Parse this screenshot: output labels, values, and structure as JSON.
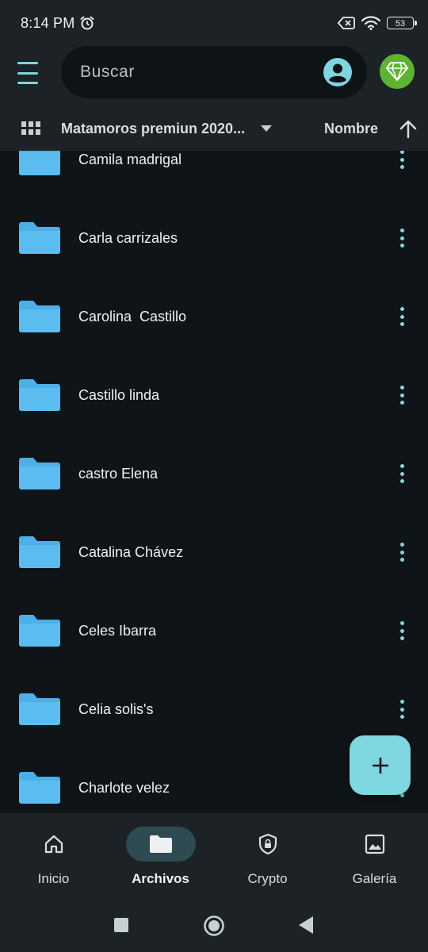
{
  "status_bar": {
    "time": "8:14 PM",
    "battery": "53",
    "icons": [
      "alarm-icon",
      "sim-error-icon",
      "wifi-icon",
      "battery-icon"
    ]
  },
  "topbar": {
    "search_placeholder": "Buscar",
    "icons": [
      "menu-icon",
      "account-icon",
      "diamond-icon"
    ]
  },
  "pathbar": {
    "folder_title": "Matamoros premiun 2020...",
    "sort_label": "Nombre",
    "icons": [
      "grid-view-icon",
      "dropdown-caret-icon",
      "sort-arrow-up-icon"
    ]
  },
  "files": [
    {
      "name": "Camila madrigal"
    },
    {
      "name": "Carla carrizales"
    },
    {
      "name": "Carolina  Castillo"
    },
    {
      "name": "Castillo linda"
    },
    {
      "name": "castro Elena"
    },
    {
      "name": "Catalina Chávez"
    },
    {
      "name": "Celes Ibarra"
    },
    {
      "name": "Celia solis's"
    },
    {
      "name": "Charlote velez"
    }
  ],
  "bottom_nav": {
    "items": [
      {
        "label": "Inicio",
        "icon": "home-icon",
        "active": false
      },
      {
        "label": "Archivos",
        "icon": "folder-icon",
        "active": true
      },
      {
        "label": "Crypto",
        "icon": "shield-lock-icon",
        "active": false
      },
      {
        "label": "Galería",
        "icon": "image-icon",
        "active": false
      }
    ]
  },
  "colors": {
    "accent": "#7fd7df",
    "folder": "#4ab0e8",
    "background": "#0f1418",
    "surface": "#1c2226",
    "premium": "#5cb531"
  }
}
